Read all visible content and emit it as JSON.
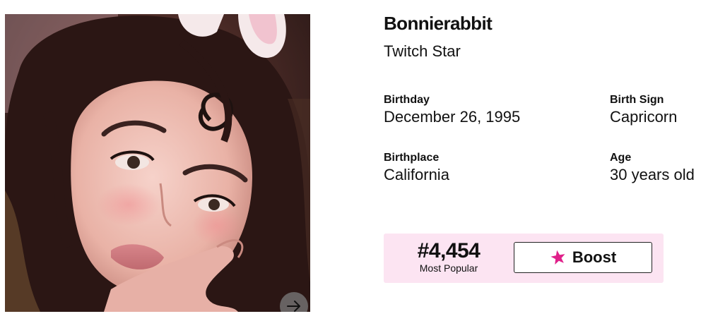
{
  "profile": {
    "name": "Bonnierabbit",
    "profession": "Twitch Star",
    "photo_alt": "Bonnierabbit"
  },
  "facts": {
    "birthday": {
      "label": "Birthday",
      "value": "December 26, 1995"
    },
    "birth_sign": {
      "label": "Birth Sign",
      "value": "Capricorn"
    },
    "birthplace": {
      "label": "Birthplace",
      "value": "California"
    },
    "age": {
      "label": "Age",
      "value": "30 years old"
    }
  },
  "rank": {
    "number": "#4,454",
    "label": "Most Popular"
  },
  "boost": {
    "label": "Boost",
    "icon": "star-icon"
  },
  "photo_controls": {
    "next_icon": "arrow-right-icon"
  },
  "colors": {
    "rank_background": "#fce4f2",
    "star": "#e0208a"
  }
}
